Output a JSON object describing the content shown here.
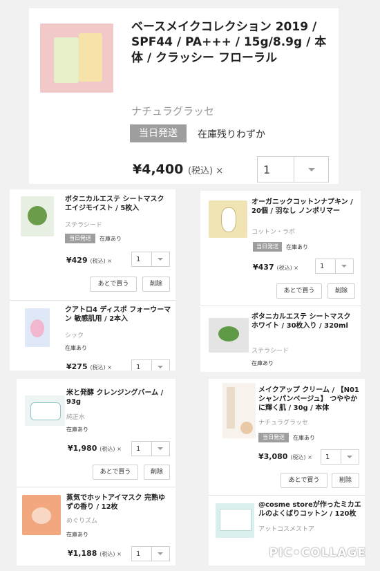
{
  "top": {
    "title": "ベースメイクコレクション 2019 / SPF44 / PA+++ / 15g/8.9g / 本体 / クラッシー フローラル",
    "brand": "ナチュラグラッセ",
    "badge": "当日発送",
    "stock": "在庫残りわずか",
    "price": "¥4,400",
    "tax": "(税込) ×",
    "qty": "1"
  },
  "items": [
    {
      "title": "ボタニカルエステ シートマスク エイジモイスト / 5枚入",
      "brand": "ステラシード",
      "badge": "当日発送",
      "stock": "在庫あり",
      "price": "¥429",
      "tax": "(税込) ×",
      "qty": "1",
      "later": "あとで買う",
      "del": "削除"
    },
    {
      "title": "オーガニックコットンナプキン / 20個 / 羽なし ノンポリマー",
      "brand": "コットン・ラボ",
      "badge": "当日発送",
      "stock": "在庫あり",
      "price": "¥437",
      "tax": "(税込) ×",
      "qty": "1",
      "later": "あとで買う",
      "del": "削除"
    },
    {
      "title": "クアトロ4 ディスポ フォーウーマン 敏感肌用 / 2本入",
      "brand": "シック",
      "stock": "在庫あり",
      "price": "¥275",
      "tax": "(税込) ×",
      "qty": "1"
    },
    {
      "title": "ボタニカルエステ シートマスク ホワイト / 30枚入り / 320ml",
      "brand": "ステラシード",
      "stock": "在庫あり"
    },
    {
      "title": "米と発酵 クレンジングバーム / 93g",
      "brand": "純正水",
      "stock": "在庫あり",
      "price": "¥1,980",
      "tax": "(税込) ×",
      "qty": "1",
      "later": "あとで買う",
      "del": "削除"
    },
    {
      "title": "メイクアップ クリーム / 【N01シャンパンベージュ】 つややかに輝く肌 / 30g / 本体",
      "brand": "ナチュラグラッセ",
      "badge": "当日発送",
      "stock": "在庫あり",
      "price": "¥3,080",
      "tax": "(税込) ×",
      "qty": "1",
      "later": "あとで買う",
      "del": "削除"
    },
    {
      "title": "蒸気でホットアイマスク 完熟ゆずの香り / 12枚",
      "brand": "めぐりズム",
      "stock": "在庫あり",
      "price": "¥1,188",
      "tax": "(税込) ×",
      "qty": "1"
    },
    {
      "title": "@cosme storeが作ったミカエルのよくばりコットン / 120枚",
      "brand": "アットコスメストア"
    }
  ],
  "watermark": "PIC•COLLAGE",
  "colors": {
    "background": "#f1f1f1",
    "badge": "#9e9e9e",
    "brand_text": "#9a9a9a"
  }
}
